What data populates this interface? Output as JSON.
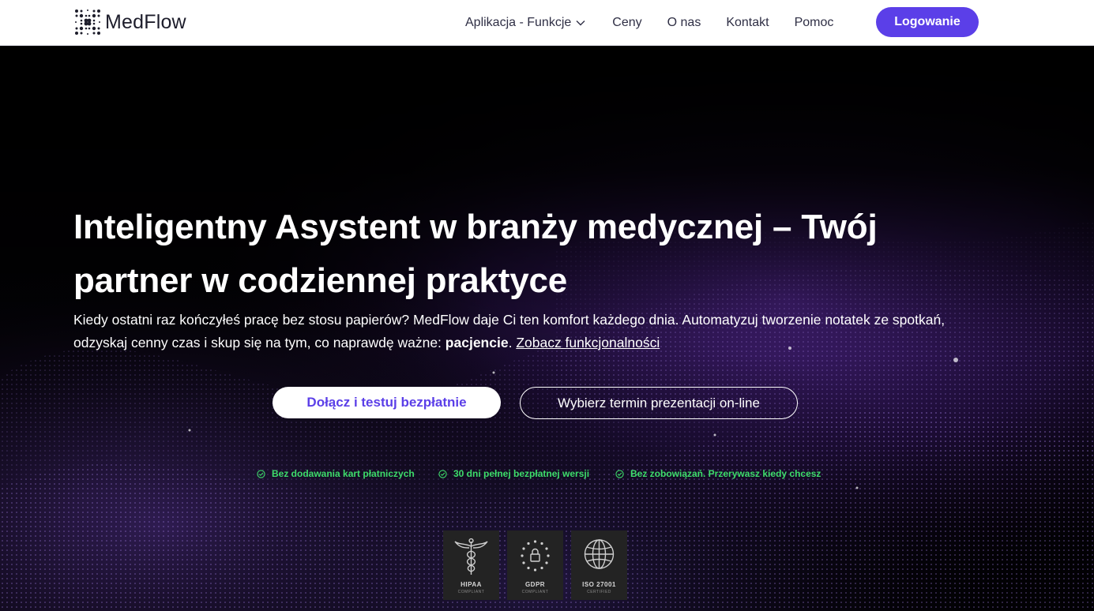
{
  "header": {
    "brand": "MedFlow",
    "nav": [
      {
        "label": "Aplikacja - Funkcje"
      },
      {
        "label": "Ceny"
      },
      {
        "label": "O nas"
      },
      {
        "label": "Kontakt"
      },
      {
        "label": "Pomoc"
      }
    ],
    "login_label": "Logowanie"
  },
  "hero": {
    "title": "Inteligentny Asystent w branży medycznej – Twój partner w codziennej praktyce",
    "description_before": "Kiedy ostatni raz kończyłeś pracę bez stosu papierów? MedFlow daje Ci ten komfort każdego dnia. Automatyzuj tworzenie notatek ze spotkań, odzyskaj cenny czas i skup się na tym, co naprawdę ważne: ",
    "description_bold": "pacjencie",
    "description_after": ". ",
    "link_label": "Zobacz funkcjonalności",
    "primary_cta": "Dołącz i testuj bezpłatnie",
    "secondary_cta": "Wybierz termin prezentacji on-line"
  },
  "features": [
    {
      "label": "Bez dodawania kart płatniczych"
    },
    {
      "label": "30 dni pełnej bezpłatnej wersji"
    },
    {
      "label": "Bez zobowiązań. Przerywasz kiedy chcesz"
    }
  ],
  "badges": [
    {
      "label": "HIPAA",
      "sub": "COMPLIANT",
      "icon": "caduceus-icon"
    },
    {
      "label": "GDPR",
      "sub": "COMPLIANT",
      "icon": "eu-stars-lock-icon"
    },
    {
      "label": "ISO 27001",
      "sub": "CERTIFIED",
      "icon": "globe-icon"
    }
  ],
  "colors": {
    "accent": "#5b3fe8",
    "feature_green": "#3ddc6a",
    "header_bg": "#ffffff",
    "hero_bg": "#000000"
  }
}
